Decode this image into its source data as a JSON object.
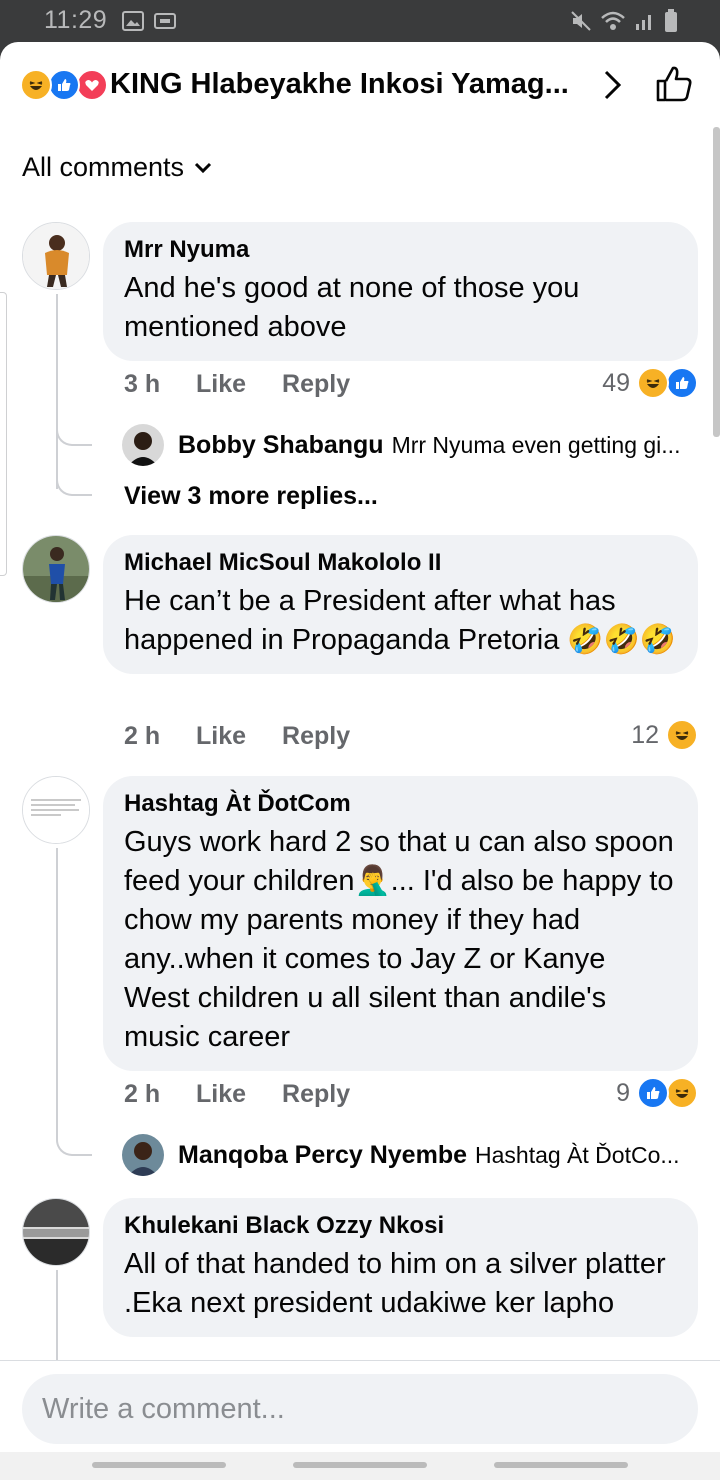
{
  "status_bar": {
    "time": "11:29"
  },
  "header": {
    "title": "KING Hlabeyakhe Inkosi Yamag...",
    "reaction_icons": [
      "laugh-icon",
      "like-icon",
      "love-icon"
    ]
  },
  "filter": {
    "label": "All comments"
  },
  "comments": [
    {
      "author": "Mrr Nyuma",
      "text": "And he's good at none of those you mentioned above",
      "time": "3 h",
      "like": "Like",
      "reply": "Reply",
      "reaction_count": "49",
      "reaction_icons": [
        "laugh-icon",
        "like-icon"
      ],
      "replies_preview": {
        "author": "Bobby Shabangu",
        "text": "Mrr Nyuma even getting gi..."
      },
      "view_more": "View 3 more replies..."
    },
    {
      "author": "Michael MicSoul Makololo II",
      "text": "He can’t be a President after what has happened in Propaganda Pretoria 🤣🤣🤣",
      "time": "2 h",
      "like": "Like",
      "reply": "Reply",
      "reaction_count": "12",
      "reaction_icons": [
        "laugh-icon"
      ]
    },
    {
      "author": "Hashtag Àt ĎotCom",
      "text": "Guys work hard 2 so that u can also spoon feed your children🤦‍♂️... I'd also be happy to chow my parents money if they had any..when it comes to Jay Z or Kanye West children u all silent than andile's music career",
      "time": "2 h",
      "like": "Like",
      "reply": "Reply",
      "reaction_count": "9",
      "reaction_icons": [
        "like-icon",
        "laugh-icon"
      ],
      "replies_preview": {
        "author": "Manqoba Percy Nyembe",
        "text": "Hashtag Àt ĎotCo..."
      }
    },
    {
      "author": "Khulekani Black Ozzy Nkosi",
      "text": "All of that handed to him on a silver platter .Eka next president udakiwe ker lapho"
    }
  ],
  "composer": {
    "placeholder": "Write a comment..."
  },
  "colors": {
    "like_blue": "#1877f2",
    "laugh_yellow": "#f7b125",
    "love_red": "#f33e58",
    "bubble": "#f0f2f5",
    "meta_gray": "#65676b"
  }
}
